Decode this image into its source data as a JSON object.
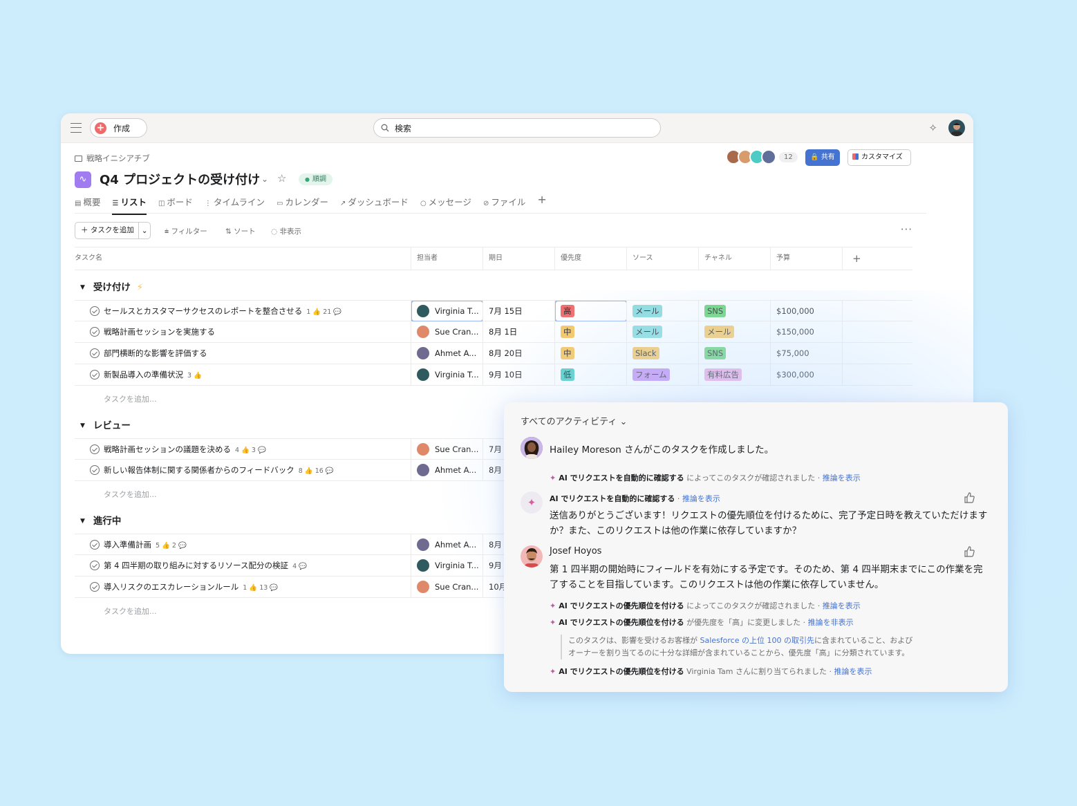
{
  "topbar": {
    "create_label": "作成",
    "search_placeholder": "検索"
  },
  "header": {
    "breadcrumb": "戦略イニシアチブ",
    "title": "Q4 プロジェクトの受け付け",
    "status": "順調",
    "member_count": "12",
    "share_label": "共有",
    "customize_label": "カスタマイズ"
  },
  "tabs": [
    {
      "label": "概要",
      "icon": "▤"
    },
    {
      "label": "リスト",
      "icon": "☰"
    },
    {
      "label": "ボード",
      "icon": "◫"
    },
    {
      "label": "タイムライン",
      "icon": "⋮"
    },
    {
      "label": "カレンダー",
      "icon": "▭"
    },
    {
      "label": "ダッシュボード",
      "icon": "↗"
    },
    {
      "label": "メッセージ",
      "icon": "○"
    },
    {
      "label": "ファイル",
      "icon": "⊘"
    }
  ],
  "toolbar": {
    "add_task": "＋ タスクを追加",
    "filter": "⩧ フィルター",
    "sort": "⇅ ソート",
    "hide": "◌ 非表示"
  },
  "columns": {
    "task": "タスク名",
    "assignee": "担当者",
    "due": "期日",
    "priority": "優先度",
    "source": "ソース",
    "channel": "チャネル",
    "budget": "予算"
  },
  "sections": [
    {
      "title": "受け付け",
      "add_task": "タスクを追加..."
    },
    {
      "title": "レビュー",
      "add_task": "タスクを追加..."
    },
    {
      "title": "進行中",
      "add_task": "タスクを追加..."
    }
  ],
  "rows": [
    {
      "name": "セールスとカスタマーサクセスのレポートを整合させる",
      "meta": "1 👍  21 💬",
      "assignee": "Virginia T...",
      "due": "7月 15日",
      "priority": "高",
      "source": "メール",
      "channel": "SNS",
      "budget": "$100,000"
    },
    {
      "name": "戦略計画セッションを実施する",
      "meta": "",
      "assignee": "Sue Cran...",
      "due": "8月 1日",
      "priority": "中",
      "source": "メール",
      "channel": "メール",
      "budget": "$150,000"
    },
    {
      "name": "部門横断的な影響を評価する",
      "meta": "",
      "assignee": "Ahmet A...",
      "due": "8月 20日",
      "priority": "中",
      "source": "Slack",
      "channel": "SNS",
      "budget": "$75,000"
    },
    {
      "name": "新製品導入の準備状況",
      "meta": "3 👍",
      "assignee": "Virginia T...",
      "due": "9月 10日",
      "priority": "低",
      "source": "フォーム",
      "channel": "有料広告",
      "budget": "$300,000"
    },
    {
      "name": "戦略計画セッションの議題を決める",
      "meta": "4 👍  3 💬",
      "assignee": "Sue Cran...",
      "due": "7月"
    },
    {
      "name": "新しい報告体制に関する関係者からのフィードバック",
      "meta": "8 👍  16 💬",
      "assignee": "Ahmet A...",
      "due": "8月"
    },
    {
      "name": "導入準備計画",
      "meta": "5 👍  2 💬",
      "assignee": "Ahmet A...",
      "due": "8月"
    },
    {
      "name": "第 4 四半期の取り組みに対するリソース配分の検証",
      "meta": "4 💬",
      "assignee": "Virginia T...",
      "due": "9月"
    },
    {
      "name": "導入リスクのエスカレーションルール",
      "meta": "1 👍  13 💬",
      "assignee": "Sue Cran...",
      "due": "10月"
    }
  ],
  "colors": {
    "high": "#f06a6a",
    "medium": "#f8c55d",
    "low": "#4ecbc4",
    "source": "#86dbdc",
    "sns": "#62d26f",
    "mail_channel": "#f8c55d",
    "form": "#c28cf0",
    "ads": "#f1a7e0"
  },
  "activity": {
    "heading": "すべてのアクティビティ ⌄",
    "created_user": "Hailey Moreson",
    "created_text": " さんがこのタスクを作成しました。",
    "line1_bold": "AI でリクエストを自動的に確認する",
    "line1_text": " によってこのタスクが確認されました · ",
    "line1_link": "推論を表示",
    "ai_name": "AI でリクエストを自動的に確認する",
    "ai_sep": " · ",
    "ai_link": "推論を表示",
    "ai_msg": "送信ありがとうございます！リクエストの優先順位を付けるために、完了予定日時を教えていただけますか？また、このリクエストは他の作業に依存していますか？",
    "josef_name": "Josef Hoyos",
    "josef_msg": "第 1 四半期の開始時にフィールドを有効にする予定です。そのため、第 4 四半期末までにこの作業を完了することを目指しています。このリクエストは他の作業に依存していません。",
    "line2_bold": "AI でリクエストの優先順位を付ける",
    "line2_text": " によってこのタスクが確認されました · ",
    "line2_link": "推論を表示",
    "line3_bold": "AI でリクエストの優先順位を付ける",
    "line3_text": " が優先度を「高」に変更しました · ",
    "line3_link": "推論を非表示",
    "quote_a": "このタスクは、影響を受けるお客様が ",
    "quote_link": "Salesforce の上位 100 の取引先",
    "quote_b": "に含まれていること、および",
    "quote_c": "オーナーを割り当てるのに十分な詳細が含まれていることから、優先度「高」に分類されています。",
    "line4_bold": "AI でリクエストの優先順位を付ける",
    "line4_text": " Virginia Tam さんに割り当てられました · ",
    "line4_link": "推論を表示"
  }
}
